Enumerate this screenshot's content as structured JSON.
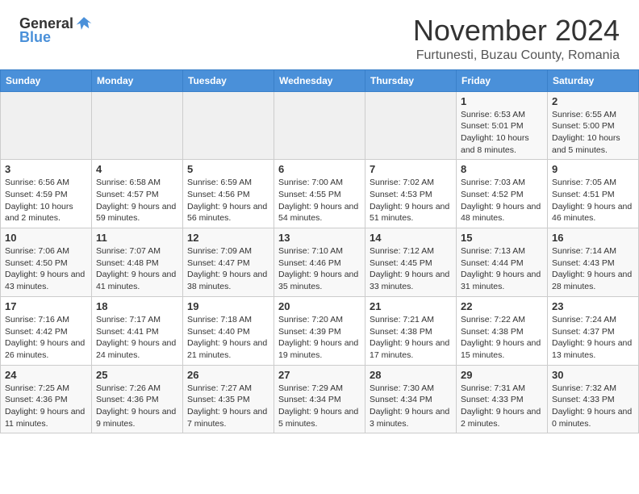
{
  "header": {
    "logo_general": "General",
    "logo_blue": "Blue",
    "month_title": "November 2024",
    "location": "Furtunesti, Buzau County, Romania"
  },
  "days_of_week": [
    "Sunday",
    "Monday",
    "Tuesday",
    "Wednesday",
    "Thursday",
    "Friday",
    "Saturday"
  ],
  "weeks": [
    [
      {
        "day": "",
        "info": ""
      },
      {
        "day": "",
        "info": ""
      },
      {
        "day": "",
        "info": ""
      },
      {
        "day": "",
        "info": ""
      },
      {
        "day": "",
        "info": ""
      },
      {
        "day": "1",
        "info": "Sunrise: 6:53 AM\nSunset: 5:01 PM\nDaylight: 10 hours and 8 minutes."
      },
      {
        "day": "2",
        "info": "Sunrise: 6:55 AM\nSunset: 5:00 PM\nDaylight: 10 hours and 5 minutes."
      }
    ],
    [
      {
        "day": "3",
        "info": "Sunrise: 6:56 AM\nSunset: 4:59 PM\nDaylight: 10 hours and 2 minutes."
      },
      {
        "day": "4",
        "info": "Sunrise: 6:58 AM\nSunset: 4:57 PM\nDaylight: 9 hours and 59 minutes."
      },
      {
        "day": "5",
        "info": "Sunrise: 6:59 AM\nSunset: 4:56 PM\nDaylight: 9 hours and 56 minutes."
      },
      {
        "day": "6",
        "info": "Sunrise: 7:00 AM\nSunset: 4:55 PM\nDaylight: 9 hours and 54 minutes."
      },
      {
        "day": "7",
        "info": "Sunrise: 7:02 AM\nSunset: 4:53 PM\nDaylight: 9 hours and 51 minutes."
      },
      {
        "day": "8",
        "info": "Sunrise: 7:03 AM\nSunset: 4:52 PM\nDaylight: 9 hours and 48 minutes."
      },
      {
        "day": "9",
        "info": "Sunrise: 7:05 AM\nSunset: 4:51 PM\nDaylight: 9 hours and 46 minutes."
      }
    ],
    [
      {
        "day": "10",
        "info": "Sunrise: 7:06 AM\nSunset: 4:50 PM\nDaylight: 9 hours and 43 minutes."
      },
      {
        "day": "11",
        "info": "Sunrise: 7:07 AM\nSunset: 4:48 PM\nDaylight: 9 hours and 41 minutes."
      },
      {
        "day": "12",
        "info": "Sunrise: 7:09 AM\nSunset: 4:47 PM\nDaylight: 9 hours and 38 minutes."
      },
      {
        "day": "13",
        "info": "Sunrise: 7:10 AM\nSunset: 4:46 PM\nDaylight: 9 hours and 35 minutes."
      },
      {
        "day": "14",
        "info": "Sunrise: 7:12 AM\nSunset: 4:45 PM\nDaylight: 9 hours and 33 minutes."
      },
      {
        "day": "15",
        "info": "Sunrise: 7:13 AM\nSunset: 4:44 PM\nDaylight: 9 hours and 31 minutes."
      },
      {
        "day": "16",
        "info": "Sunrise: 7:14 AM\nSunset: 4:43 PM\nDaylight: 9 hours and 28 minutes."
      }
    ],
    [
      {
        "day": "17",
        "info": "Sunrise: 7:16 AM\nSunset: 4:42 PM\nDaylight: 9 hours and 26 minutes."
      },
      {
        "day": "18",
        "info": "Sunrise: 7:17 AM\nSunset: 4:41 PM\nDaylight: 9 hours and 24 minutes."
      },
      {
        "day": "19",
        "info": "Sunrise: 7:18 AM\nSunset: 4:40 PM\nDaylight: 9 hours and 21 minutes."
      },
      {
        "day": "20",
        "info": "Sunrise: 7:20 AM\nSunset: 4:39 PM\nDaylight: 9 hours and 19 minutes."
      },
      {
        "day": "21",
        "info": "Sunrise: 7:21 AM\nSunset: 4:38 PM\nDaylight: 9 hours and 17 minutes."
      },
      {
        "day": "22",
        "info": "Sunrise: 7:22 AM\nSunset: 4:38 PM\nDaylight: 9 hours and 15 minutes."
      },
      {
        "day": "23",
        "info": "Sunrise: 7:24 AM\nSunset: 4:37 PM\nDaylight: 9 hours and 13 minutes."
      }
    ],
    [
      {
        "day": "24",
        "info": "Sunrise: 7:25 AM\nSunset: 4:36 PM\nDaylight: 9 hours and 11 minutes."
      },
      {
        "day": "25",
        "info": "Sunrise: 7:26 AM\nSunset: 4:36 PM\nDaylight: 9 hours and 9 minutes."
      },
      {
        "day": "26",
        "info": "Sunrise: 7:27 AM\nSunset: 4:35 PM\nDaylight: 9 hours and 7 minutes."
      },
      {
        "day": "27",
        "info": "Sunrise: 7:29 AM\nSunset: 4:34 PM\nDaylight: 9 hours and 5 minutes."
      },
      {
        "day": "28",
        "info": "Sunrise: 7:30 AM\nSunset: 4:34 PM\nDaylight: 9 hours and 3 minutes."
      },
      {
        "day": "29",
        "info": "Sunrise: 7:31 AM\nSunset: 4:33 PM\nDaylight: 9 hours and 2 minutes."
      },
      {
        "day": "30",
        "info": "Sunrise: 7:32 AM\nSunset: 4:33 PM\nDaylight: 9 hours and 0 minutes."
      }
    ]
  ]
}
